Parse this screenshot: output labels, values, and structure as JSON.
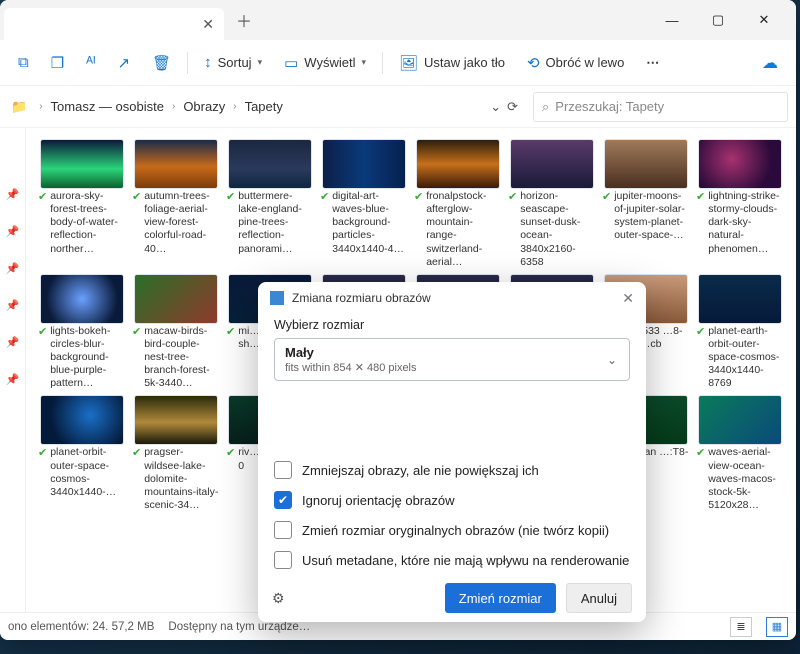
{
  "tab": {
    "close": "✕"
  },
  "newtab": "＋",
  "toolbar": {
    "sort": "Sortuj",
    "view": "Wyświetl",
    "set_bg": "Ustaw jako tło",
    "rotate": "Obróć w lewo"
  },
  "breadcrumb": {
    "a": "Tomasz — osobiste",
    "b": "Obrazy",
    "c": "Tapety"
  },
  "search": {
    "placeholder": "Przeszukaj: Tapety"
  },
  "thumbs": {
    "t1": "aurora-sky-forest-trees-body-of-water-reflection-norther…",
    "t2": "autumn-trees-foliage-aerial-view-forest-colorful-road-40…",
    "t3": "buttermere-lake-england-pine-trees-reflection-panorami…",
    "t4": "digital-art-waves-blue-background-particles-3440x1440-4…",
    "t5": "fronalpstock-afterglow-mountain-range-switzerland-aerial…",
    "t6": "horizon-seascape-sunset-dusk-ocean-3840x2160-6358",
    "t7": "jupiter-moons-of-jupiter-solar-system-planet-outer-space-…",
    "t8": "lightning-strike-stormy-clouds-dark-sky-natural-phenomen…",
    "t9": "lights-bokeh-circles-blur-background-blue-purple-pattern…",
    "t10": "macaw-birds-bird-couple-nest-tree-branch-forest-5k-3440…",
    "t11": "mi… az… 0K… sh…",
    "t12": "…166533 …8-c71b …cb",
    "t13": "planet-earth-orbit-outer-space-cosmos-3440x1440-8769",
    "t14": "planet-orbit-outer-space-cosmos-3440x1440-…",
    "t15": "pragser-wildsee-lake-dolomite-mountains-italy-scenic-34…",
    "t16": "riv… all… ces… 0",
    "t17": "…yak-an …:T8-uns …",
    "t18": "waves-aerial-view-ocean-waves-macos-stock-5k-5120x28…"
  },
  "status": {
    "count": "ono elementów: 24. 57,2 MB",
    "avail": "Dostępny na tym urządze…"
  },
  "dlg": {
    "title": "Zmiana rozmiaru obrazów",
    "pick": "Wybierz rozmiar",
    "sel": "Mały",
    "sub": "fits within 854 ✕ 480 pixels",
    "c1": "Zmniejszaj obrazy, ale nie powiększaj ich",
    "c2": "Ignoruj orientację obrazów",
    "c3": "Zmień rozmiar oryginalnych obrazów (nie twórz kopii)",
    "c4": "Usuń metadane, które nie mają wpływu na renderowanie",
    "ok": "Zmień rozmiar",
    "cancel": "Anuluj"
  }
}
